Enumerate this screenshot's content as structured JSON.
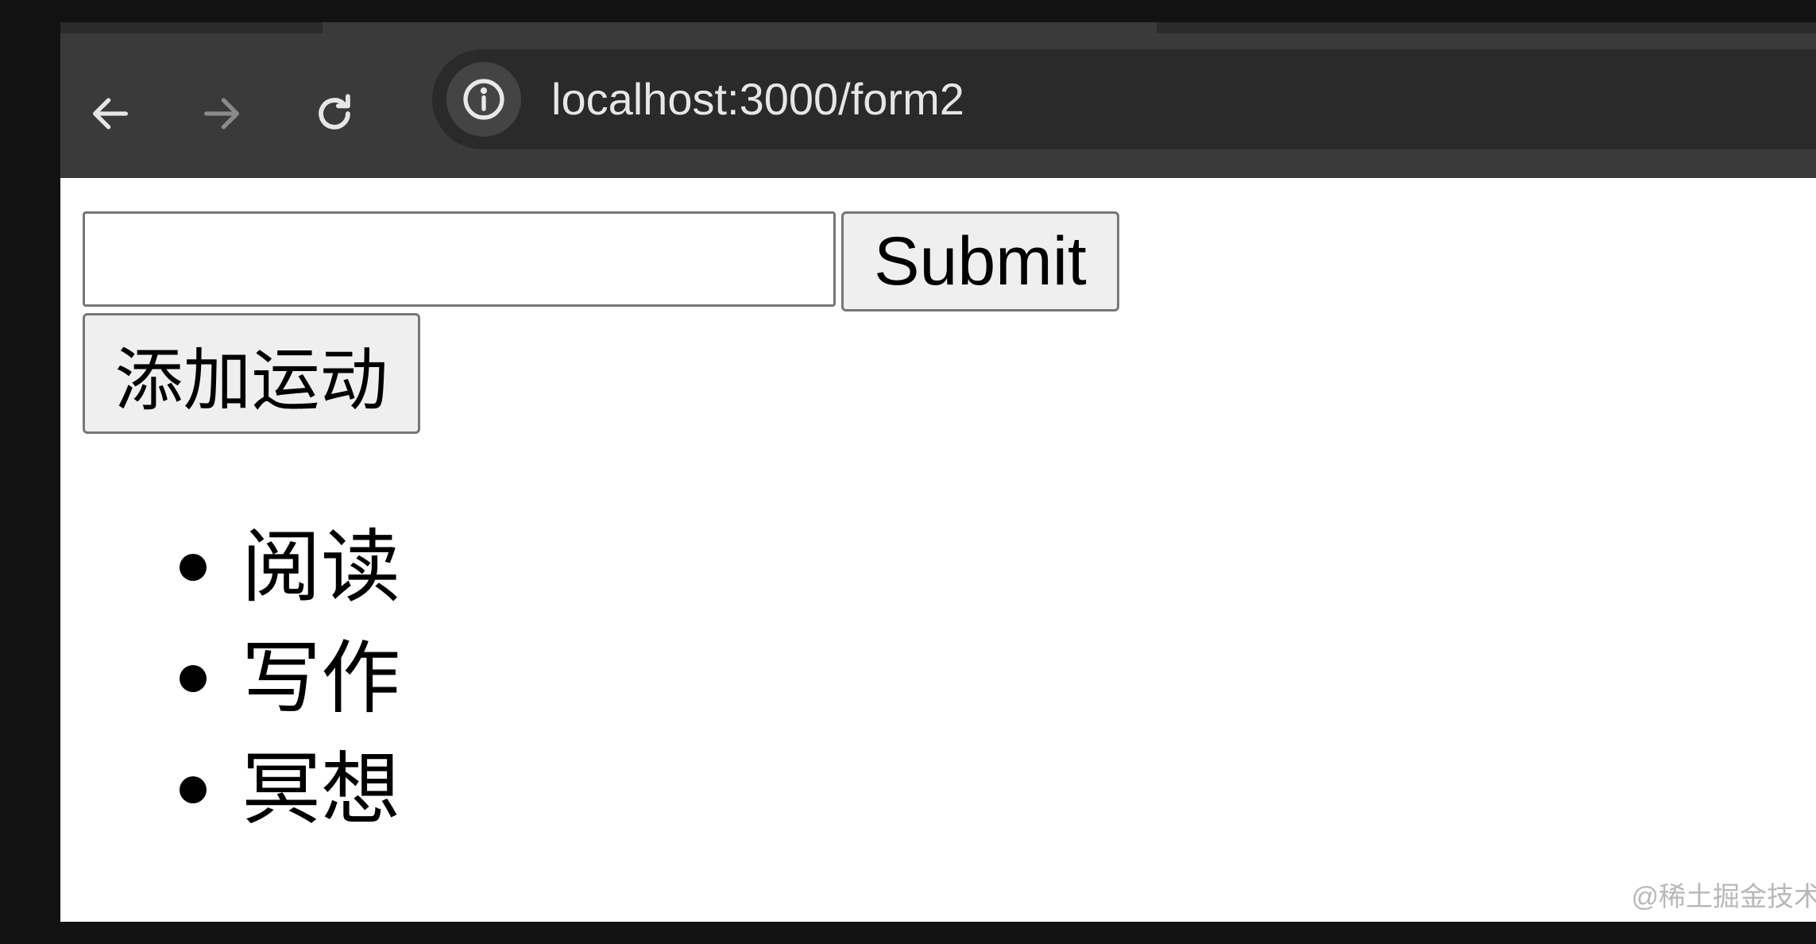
{
  "browser": {
    "url": "localhost:3000/form2",
    "back_icon": "arrow-left-icon",
    "forward_icon": "arrow-right-icon",
    "reload_icon": "reload-icon",
    "site_info_icon": "info-icon"
  },
  "form": {
    "input_value": "",
    "submit_label": "Submit",
    "add_sport_label": "添加运动"
  },
  "sports": [
    {
      "label": "阅读"
    },
    {
      "label": "写作"
    },
    {
      "label": "冥想"
    }
  ],
  "watermark": "@稀土掘金技术",
  "colors": {
    "toolbar": "#3a3a3a",
    "omnibox": "#2a2a2a",
    "button_bg": "#efefef",
    "border": "#767676"
  }
}
